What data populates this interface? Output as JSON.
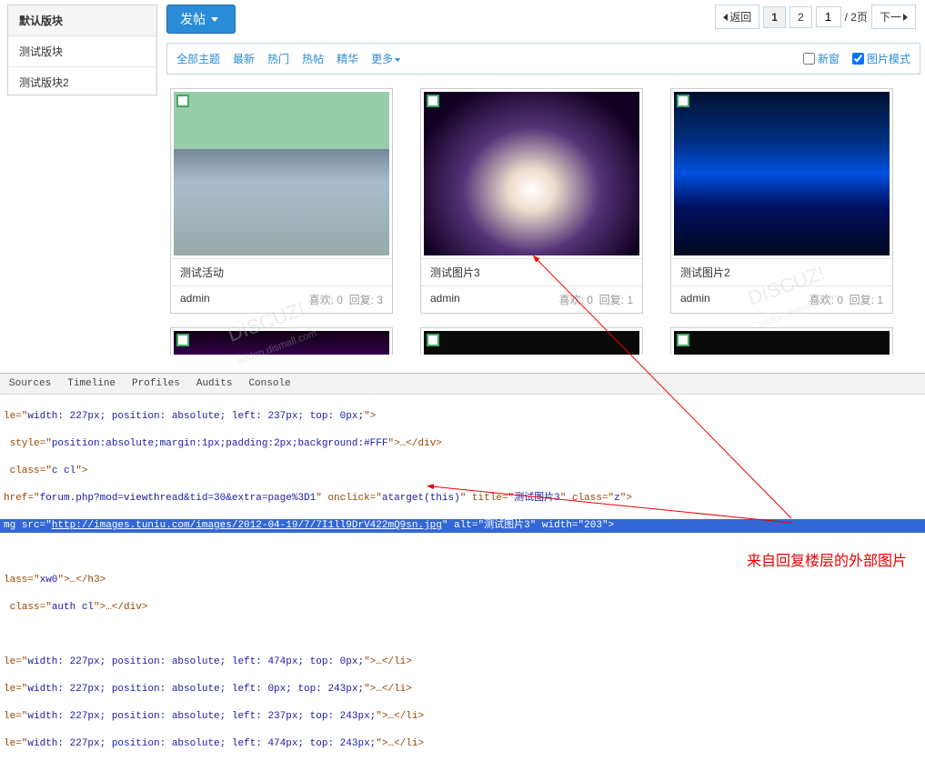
{
  "sidebar": {
    "items": [
      {
        "label": "默认版块",
        "active": true
      },
      {
        "label": "测试版块",
        "active": false
      },
      {
        "label": "测试版块2",
        "active": false
      }
    ]
  },
  "toolbar": {
    "post_label": "发帖"
  },
  "pager": {
    "back": "返回",
    "page1": "1",
    "page2": "2",
    "input": "1",
    "total": "/ 2页",
    "next": "下一"
  },
  "filters": {
    "all": "全部主题",
    "latest": "最新",
    "hot": "热门",
    "hotpost": "热帖",
    "essence": "精华",
    "more": "更多",
    "newwin": "新窗",
    "imgmode": "图片模式"
  },
  "cards": [
    {
      "title": "测试活动",
      "author": "admin",
      "likes": "喜欢: 0",
      "replies": "回复: 3"
    },
    {
      "title": "测试图片3",
      "author": "admin",
      "likes": "喜欢: 0",
      "replies": "回复: 1"
    },
    {
      "title": "测试图片2",
      "author": "admin",
      "likes": "喜欢: 0",
      "replies": "回复: 1"
    }
  ],
  "devtools": {
    "tabs": [
      "Sources",
      "Timeline",
      "Profiles",
      "Audits",
      "Console"
    ],
    "lines": {
      "l1a": "le=\"",
      "l1b": "width: 227px; position: absolute; left: 237px; top: 0px;",
      "l1c": "\">",
      "l2a": "style=\"",
      "l2b": "position:absolute;margin:1px;padding:2px;background:#FFF",
      "l2c": "\">…</div>",
      "l3a": "class=\"",
      "l3b": "c cl",
      "l3c": "\">",
      "l4a": "href=\"",
      "l4b": "forum.php?mod=viewthread&tid=30&extra=page%3D1",
      "l4c": "\" onclick=\"",
      "l4d": "atarget(this)",
      "l4e": "\" title=\"",
      "l4f": "测试图片3",
      "l4g": "\" class=\"",
      "l4h": "z",
      "l4i": "\">",
      "l5a": "mg src=\"",
      "l5b": "http://images.tuniu.com/images/2012-04-19/7/7I1ll9DrV422mQ9sn.jpg",
      "l5c": "\" alt=\"",
      "l5d": "测试图片3",
      "l5e": "\" width=\"",
      "l5f": "203",
      "l5g": "\">",
      "l7a": "lass=\"",
      "l7b": "xw0",
      "l7c": "\">…</h3>",
      "l8a": "class=\"",
      "l8b": "auth cl",
      "l8c": "\">…</div>",
      "l10a": "le=\"",
      "l10b": "width: 227px; position: absolute; left: 474px; top: 0px;",
      "l10c": "\">…</li>",
      "l11a": "le=\"",
      "l11b": "width: 227px; position: absolute; left: 0px; top: 243px;",
      "l11c": "\">…</li>",
      "l12a": "le=\"",
      "l12b": "width: 227px; position: absolute; left: 237px; top: 243px;",
      "l12c": "\">…</li>",
      "l13a": "le=\"",
      "l13b": "width: 227px; position: absolute; left: 474px; top: 243px;",
      "l13c": "\">…</li>"
    }
  },
  "annotation": "来自回复楼层的外部图片",
  "watermark": "DISCUZ!\naddon.dismall.com"
}
